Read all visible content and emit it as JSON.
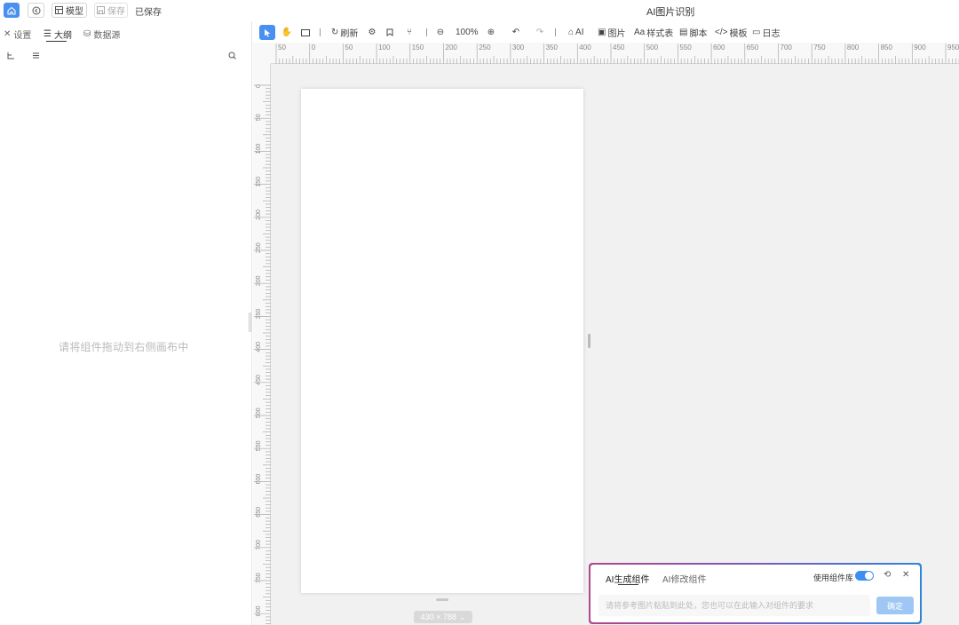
{
  "topbar": {
    "model_label": "模型",
    "save_label": "保存",
    "saved_status": "已保存",
    "app_title": "AI图片识别"
  },
  "left_panel": {
    "tabs": [
      {
        "label": "设置",
        "icon": "settings-icon"
      },
      {
        "label": "大纲",
        "icon": "outline-icon"
      },
      {
        "label": "数据源",
        "icon": "database-icon"
      }
    ],
    "active_tab": "大纲",
    "empty_hint": "请将组件拖动到右侧画布中"
  },
  "toolbar": {
    "refresh_label": "刷新",
    "zoom_level": "100%",
    "ai_label": "AI",
    "image_label": "图片",
    "stylesheet_label": "样式表",
    "script_label": "脚本",
    "template_label": "模板",
    "log_label": "日志"
  },
  "ruler": {
    "h_ticks": [
      "50",
      "0",
      "50",
      "100",
      "150",
      "200",
      "250",
      "300",
      "350",
      "400",
      "450",
      "500",
      "550",
      "600",
      "650",
      "700",
      "750",
      "800",
      "850",
      "900",
      "950"
    ],
    "v_ticks": [
      "0",
      "50",
      "100",
      "150",
      "200",
      "250",
      "300",
      "350",
      "400",
      "450",
      "500",
      "550",
      "600",
      "650",
      "700",
      "750",
      "800"
    ]
  },
  "canvas": {
    "size_badge": "430 × 788"
  },
  "ai_panel": {
    "tab_generate": "AI生成组件",
    "tab_modify": "AI修改组件",
    "use_library_label": "使用组件库",
    "use_library_on": true,
    "input_placeholder": "请将参考图片粘贴到此处，您也可以在此输入对组件的要求",
    "confirm_label": "确定"
  },
  "colors": {
    "accent": "#4a90f0",
    "canvas_bg": "#f1f1f1",
    "ai_border_start": "#b0478f",
    "ai_border_end": "#2f84d6"
  }
}
